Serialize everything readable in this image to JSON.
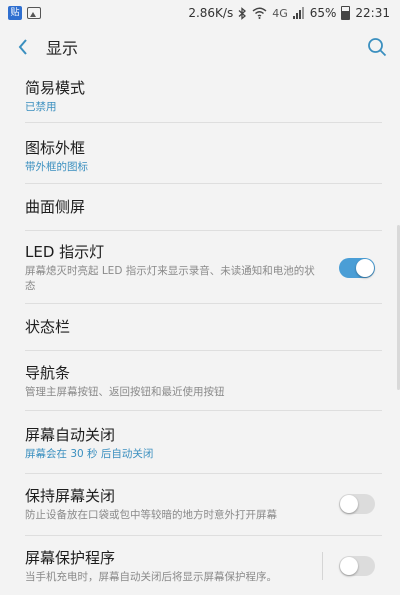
{
  "status_bar": {
    "notification_icon_text": "贴",
    "network_speed": "2.86K/s",
    "network_type": "4G",
    "battery_percent": "65%",
    "battery_level": 0.65,
    "time": "22:31"
  },
  "header": {
    "title": "显示"
  },
  "items": [
    {
      "title": "简易模式",
      "subtitle": "已禁用"
    },
    {
      "title": "图标外框",
      "subtitle": "带外框的图标"
    },
    {
      "title": "曲面侧屏",
      "subtitle": ""
    },
    {
      "title": "LED 指示灯",
      "subtitle": "屏幕熄灭时亮起 LED 指示灯来显示录音、未读通知和电池的状态",
      "toggle": "on"
    },
    {
      "title": "状态栏",
      "subtitle": ""
    },
    {
      "title": "导航条",
      "subtitle": "管理主屏幕按钮、返回按钮和最近使用按钮"
    },
    {
      "title": "屏幕自动关闭",
      "subtitle": "屏幕会在 30 秒 后自动关闭"
    },
    {
      "title": "保持屏幕关闭",
      "subtitle": "防止设备放在口袋或包中等较暗的地方时意外打开屏幕",
      "toggle": "off"
    },
    {
      "title": "屏幕保护程序",
      "subtitle": "当手机充电时，屏幕自动关闭后将显示屏幕保护程序。",
      "toggle": "off"
    }
  ],
  "colors": {
    "accent": "#4a9ed6",
    "subtitle_blue": "#3a8fbf",
    "background": "#f3f3f3"
  }
}
